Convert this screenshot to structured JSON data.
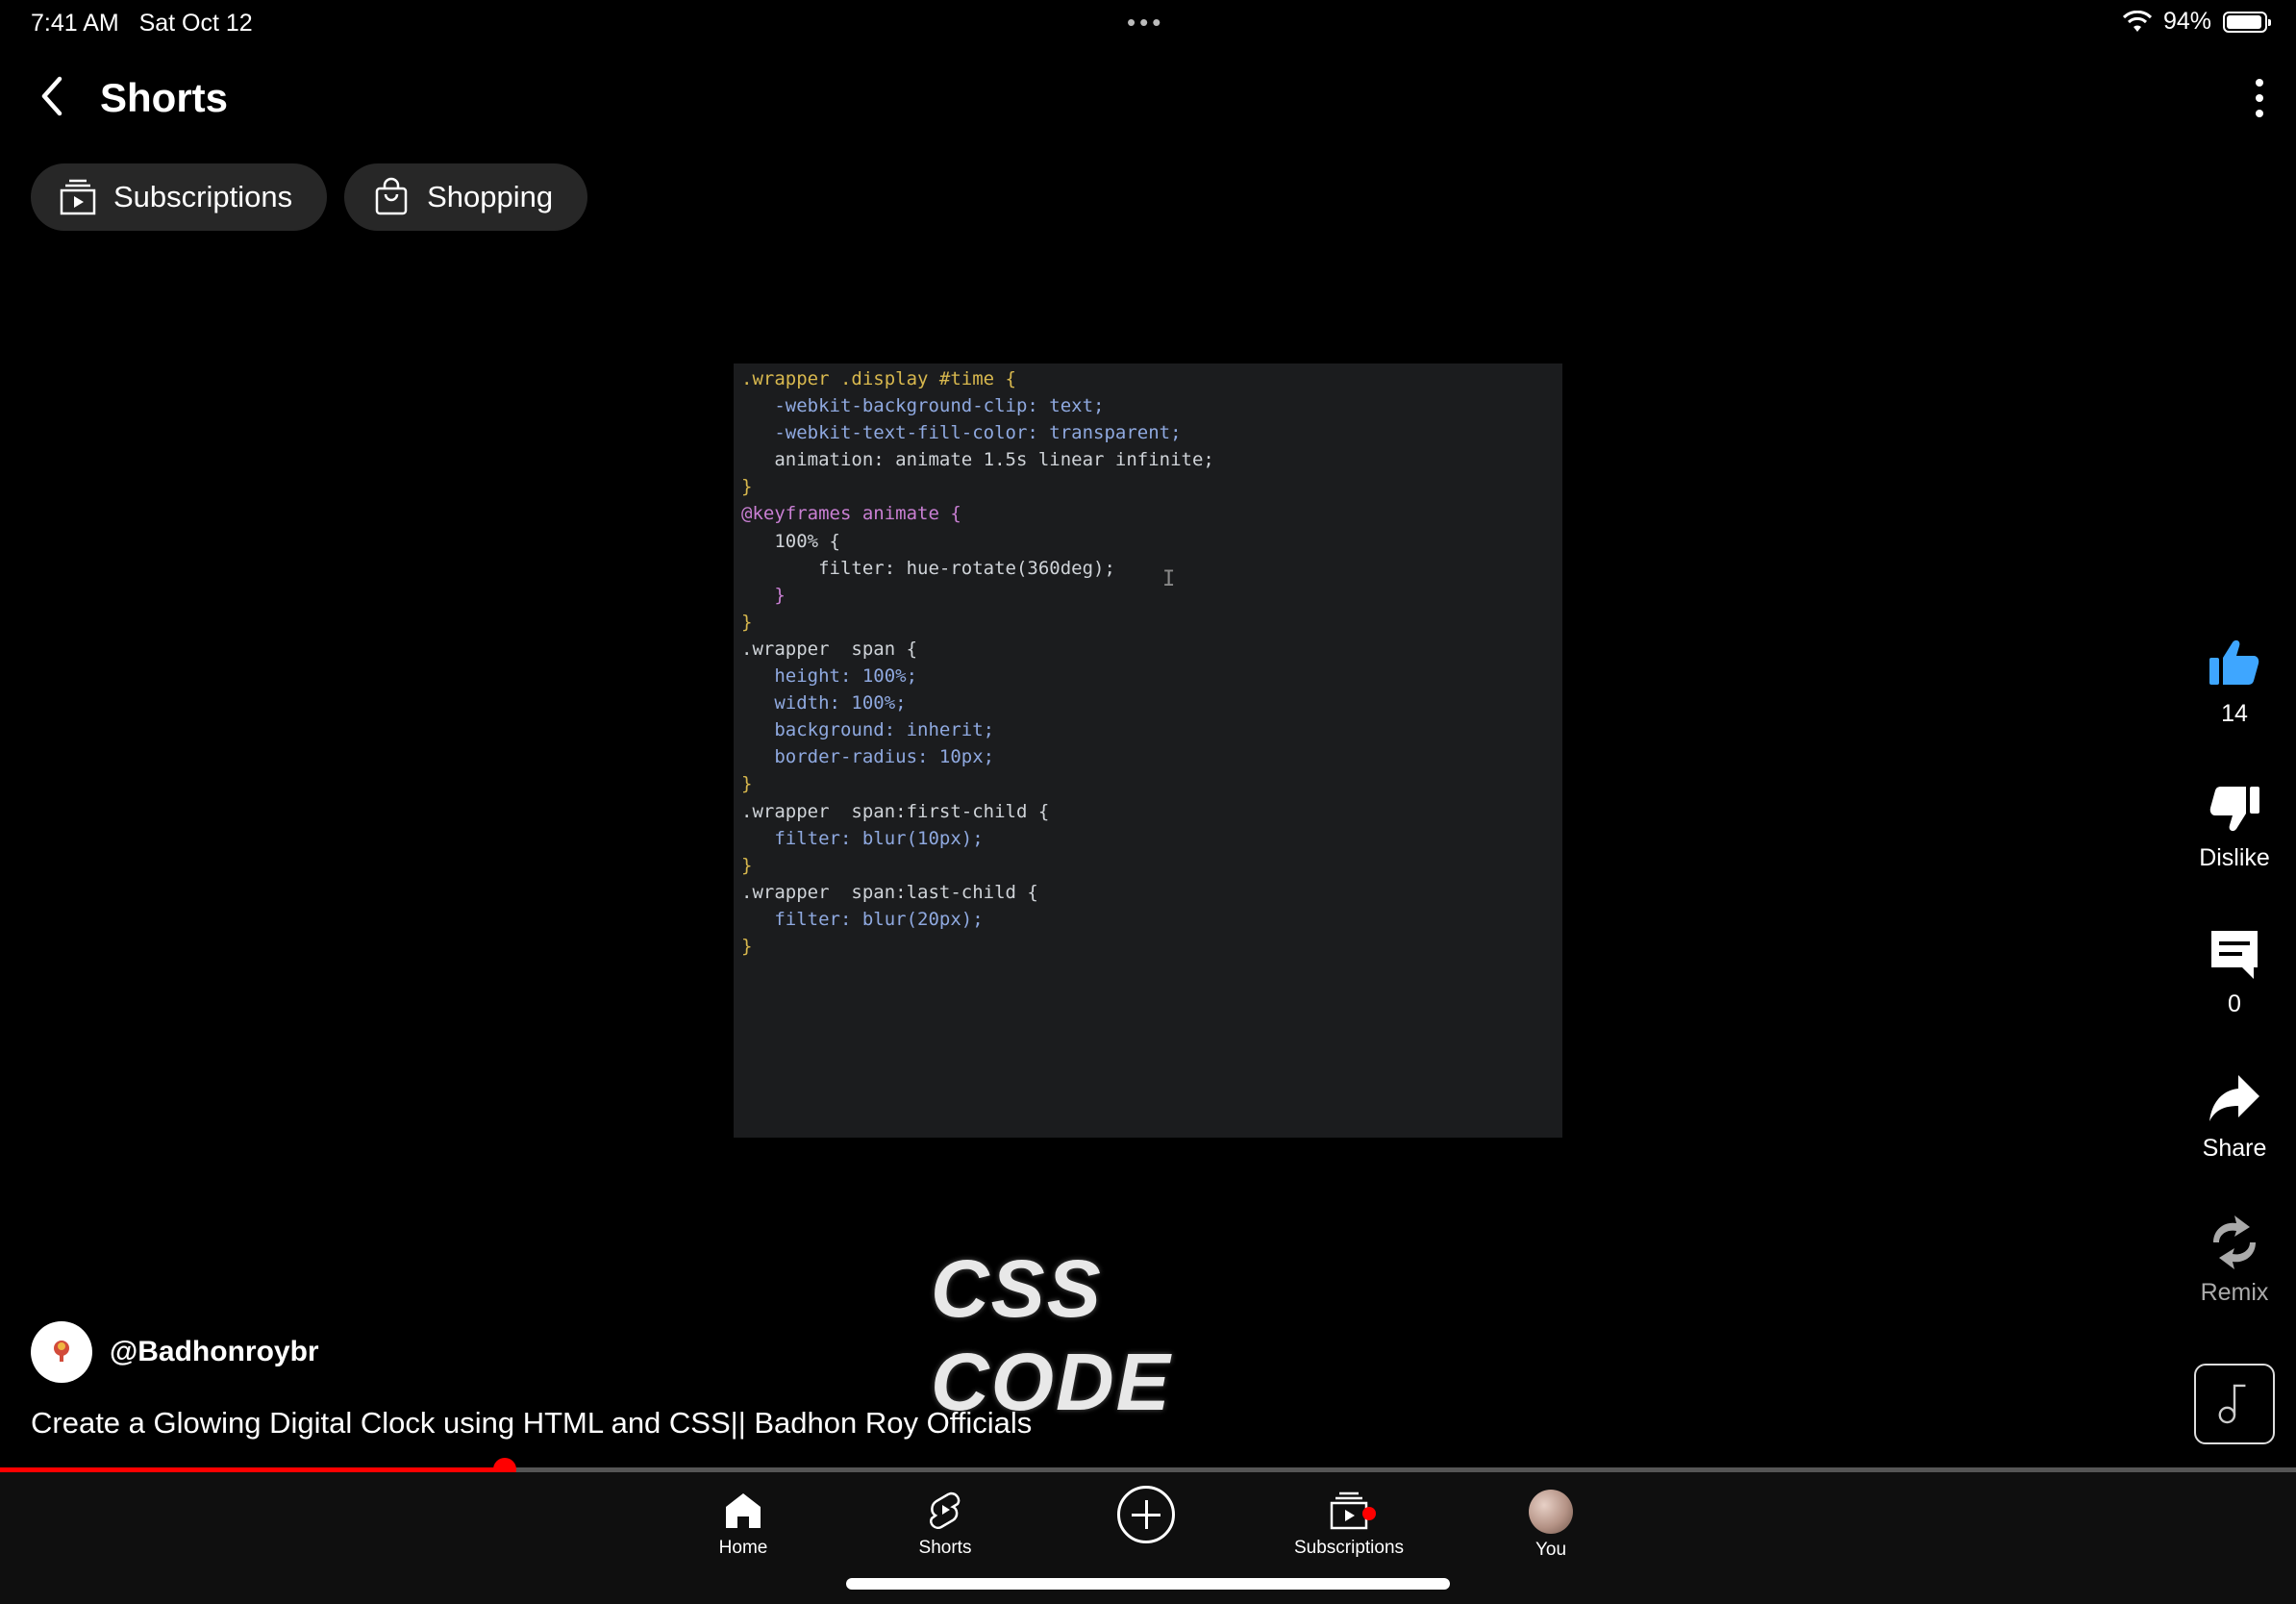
{
  "status": {
    "time": "7:41 AM",
    "date": "Sat Oct 12",
    "battery": "94%"
  },
  "header": {
    "title": "Shorts"
  },
  "chips": [
    {
      "label": "Subscriptions",
      "icon": "subscriptions-icon"
    },
    {
      "label": "Shopping",
      "icon": "shopping-bag-icon"
    }
  ],
  "video": {
    "code_lines": [
      ".wrapper .display #time {",
      "   -webkit-background-clip: text;",
      "   -webkit-text-fill-color: transparent;",
      "   animation: animate 1.5s linear infinite;",
      "}",
      "@keyframes animate {",
      "   100% {",
      "       filter: hue-rotate(360deg);",
      "   }",
      "}",
      ".wrapper  span {",
      "   height: 100%;",
      "   width: 100%;",
      "   background: inherit;",
      "   border-radius: 10px;",
      "}",
      ".wrapper  span:first-child {",
      "   filter: blur(10px);",
      "}",
      ".wrapper  span:last-child {",
      "   filter: blur(20px);",
      "}"
    ],
    "overlay_text": "CSS CODE",
    "channel": "@Badhonroybr",
    "title": "Create a Glowing Digital Clock using HTML and CSS|| Badhon Roy Officials",
    "progress": 0.22
  },
  "actions": {
    "like_count": "14",
    "dislike_label": "Dislike",
    "comment_count": "0",
    "share_label": "Share",
    "remix_label": "Remix"
  },
  "nav": {
    "home": "Home",
    "shorts": "Shorts",
    "subscriptions": "Subscriptions",
    "you": "You"
  },
  "colors": {
    "accent": "#ff0000",
    "like_blue": "#3ea6ff",
    "chip_bg": "#272727"
  }
}
